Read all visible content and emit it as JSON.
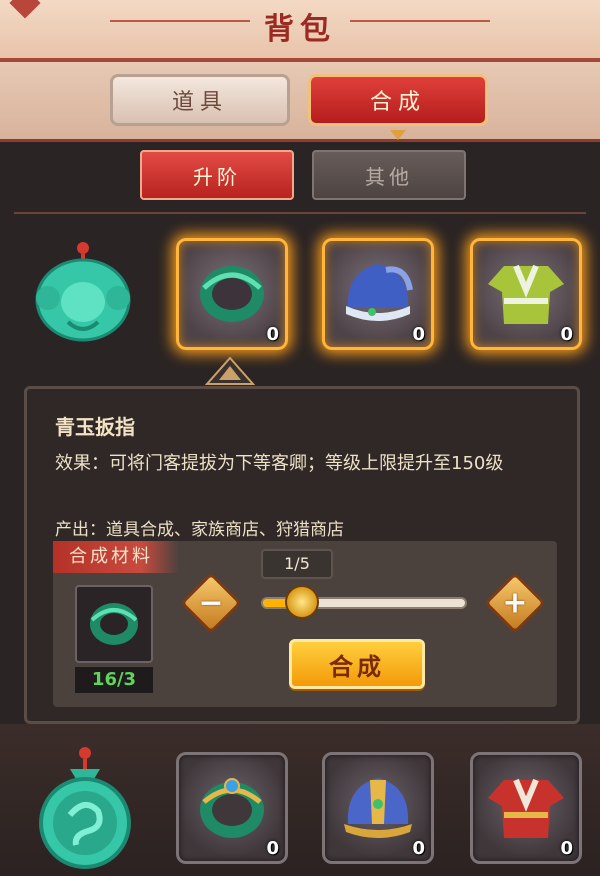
{
  "header": {
    "title": "背包"
  },
  "main_tabs": [
    {
      "label": "道具",
      "active": false
    },
    {
      "label": "合成",
      "active": true
    }
  ],
  "sub_tabs": [
    {
      "label": "升阶",
      "active": true
    },
    {
      "label": "其他",
      "active": false
    }
  ],
  "top_row": {
    "source_icon": "jade-pendant-icon",
    "targets": [
      {
        "icon": "jade-ring-icon",
        "count": "0"
      },
      {
        "icon": "blue-hat-icon",
        "count": "0"
      },
      {
        "icon": "green-robe-icon",
        "count": "0"
      }
    ]
  },
  "detail": {
    "name": "青玉扳指",
    "effect": "效果：可将门客提拔为下等客卿；等级上限提升至150级",
    "source": "产出：道具合成、家族商店、狩猎商店",
    "synthesis": {
      "label": "合成材料",
      "material_icon": "jade-ring-icon",
      "material_count": "16/3",
      "quantity_display": "1/5",
      "quantity_fraction": 0.2,
      "minus": "−",
      "plus": "+",
      "button_label": "合成"
    }
  },
  "bottom_row": {
    "source_icon": "jade-dragon-medallion-icon",
    "targets": [
      {
        "icon": "jeweled-ring-icon",
        "count": "0"
      },
      {
        "icon": "jeweled-blue-hat-icon",
        "count": "0"
      },
      {
        "icon": "red-robe-icon",
        "count": "0"
      }
    ]
  },
  "colors": {
    "accent_red": "#b8231f",
    "glow_orange": "#f59a1c",
    "button_gold": "#f39a0a",
    "count_green": "#5fd35a"
  }
}
